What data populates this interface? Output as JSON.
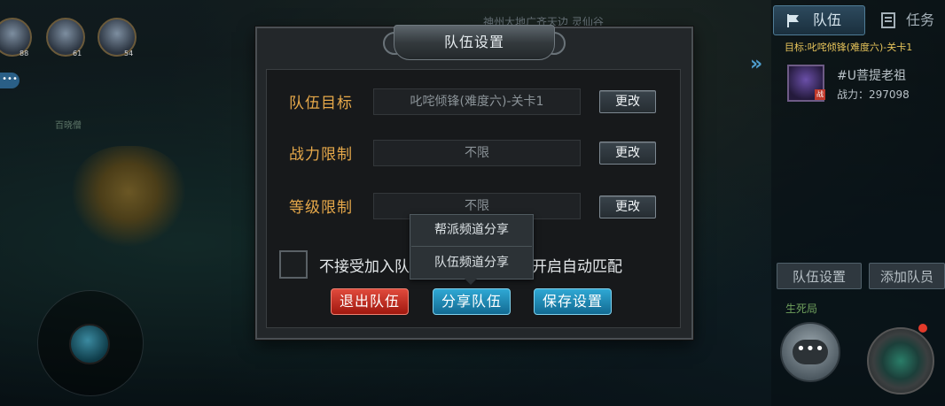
{
  "background": {
    "map_title": "神州大地广齐天边 灵仙谷",
    "npc_label": "百晓僧",
    "avatars": [
      {
        "level": "88"
      },
      {
        "level": "61"
      },
      {
        "level": "54"
      }
    ],
    "left_chat_icon": "more-dots-icon",
    "joystick_icon": "joystick-icon"
  },
  "right_panel": {
    "tabs": [
      {
        "label": "队伍",
        "icon": "flag-icon",
        "active": true
      },
      {
        "label": "任务",
        "icon": "task-icon",
        "active": false
      }
    ],
    "goal": "目标:叱咤倾锋(难度六)-关卡1",
    "member": {
      "name": "#U菩提老祖",
      "tag": "战",
      "power": "战力：297098"
    },
    "expand_icon": "»",
    "buttons": {
      "team_settings": "队伍设置",
      "add_member": "添加队员"
    },
    "life_death": "生死局",
    "chat_icon": "chat-bubble-icon",
    "skill_icon": "skill-icon"
  },
  "dialog": {
    "title": "队伍设置",
    "rows": [
      {
        "label": "队伍目标",
        "value": "叱咤倾锋(难度六)-关卡1",
        "button": "更改"
      },
      {
        "label": "战力限制",
        "value": "不限",
        "button": "更改"
      },
      {
        "label": "等级限制",
        "value": "不限",
        "button": "更改"
      }
    ],
    "checkbox": {
      "checked": false,
      "text_left": "不接受加入队",
      "text_right": "开启自动匹配"
    },
    "actions": {
      "quit": "退出队伍",
      "share": "分享队伍",
      "save": "保存设置"
    },
    "share_menu": {
      "items": [
        "帮派频道分享",
        "队伍频道分享"
      ]
    }
  },
  "colors": {
    "label_orange": "#e7a94a",
    "goal_yellow": "#e6c35a",
    "quit_red": "#c0392b",
    "action_blue": "#1f8ab8"
  }
}
